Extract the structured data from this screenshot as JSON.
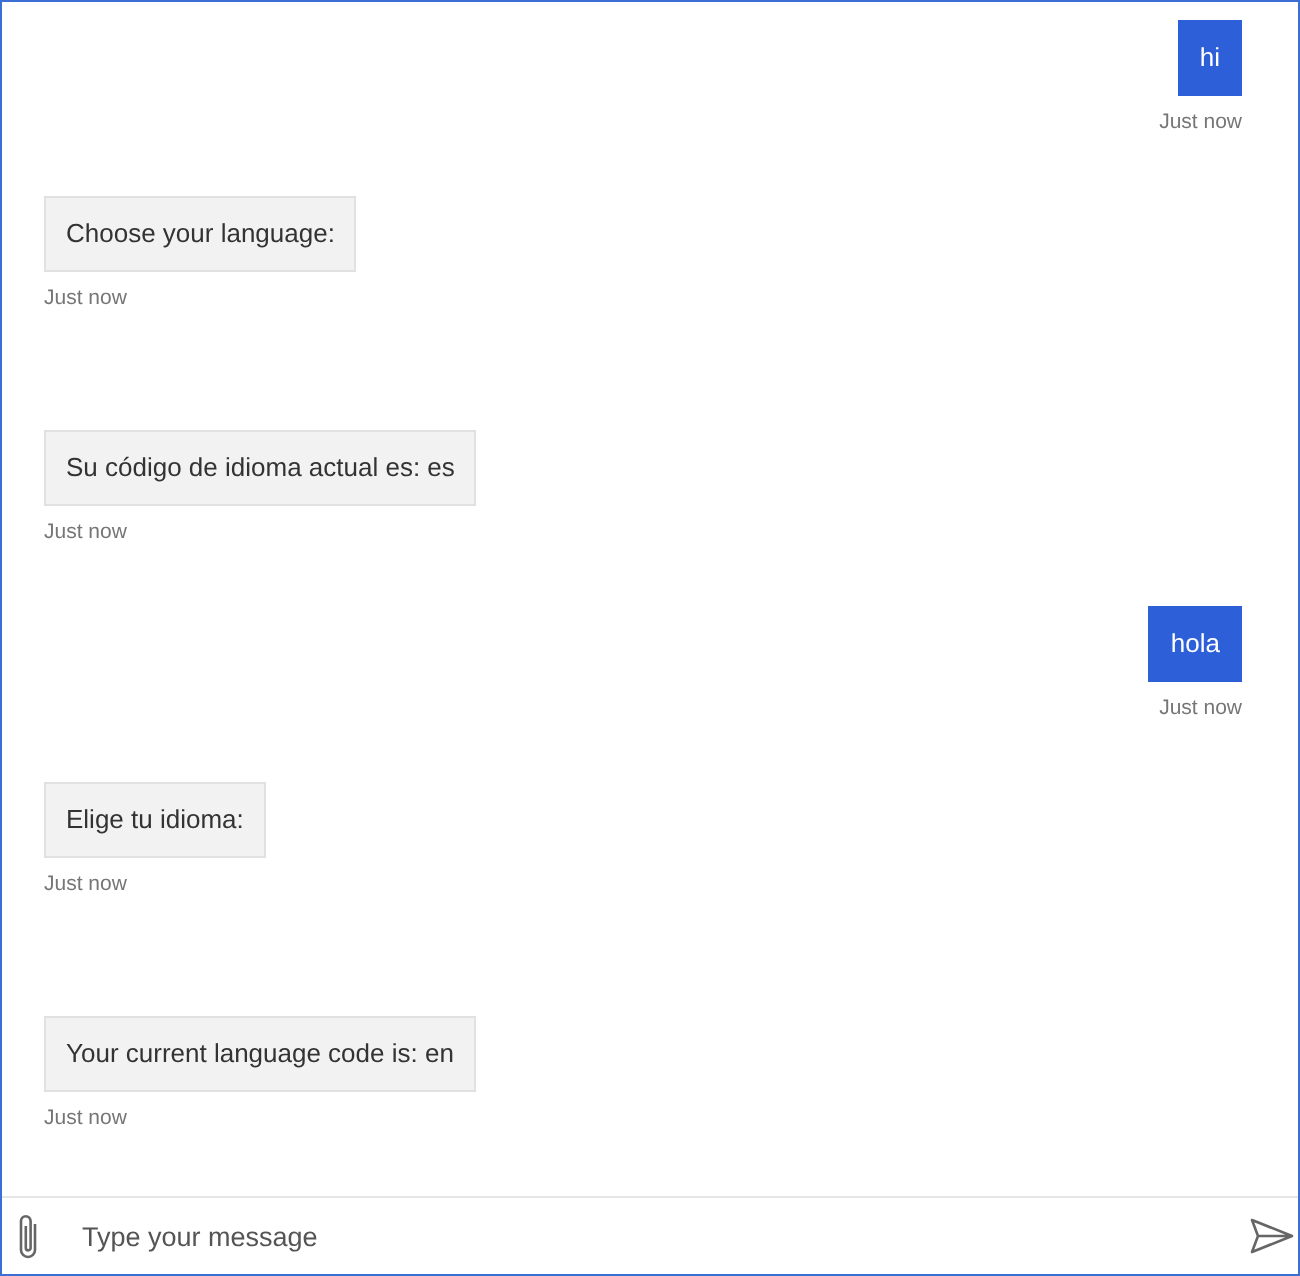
{
  "messages": [
    {
      "kind": "user",
      "text": "hi",
      "timestamp": "Just now"
    },
    {
      "kind": "bot",
      "text": "Choose your language:",
      "timestamp": "Just now"
    },
    {
      "kind": "bot",
      "text": "Su código de idioma actual es: es",
      "timestamp": "Just now"
    },
    {
      "kind": "user",
      "text": "hola",
      "timestamp": "Just now"
    },
    {
      "kind": "bot",
      "text": "Elige tu idioma:",
      "timestamp": "Just now"
    },
    {
      "kind": "bot",
      "text": "Your current language code is: en",
      "timestamp": "Just now"
    }
  ],
  "composer": {
    "placeholder": "Type your message"
  }
}
